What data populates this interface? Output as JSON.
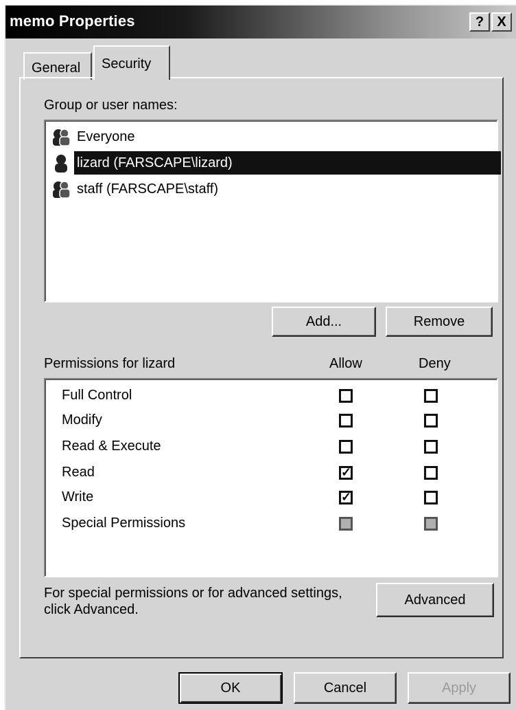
{
  "window": {
    "title": "memo Properties",
    "help_label": "?",
    "close_label": "X"
  },
  "tabs": [
    {
      "label": "General",
      "active": false
    },
    {
      "label": "Security",
      "active": true
    }
  ],
  "groups": {
    "label": "Group or user names:",
    "items": [
      {
        "label": "Everyone",
        "icon": "group-icon",
        "selected": false
      },
      {
        "label": "lizard (FARSCAPE\\lizard)",
        "icon": "user-icon",
        "selected": true
      },
      {
        "label": "staff (FARSCAPE\\staff)",
        "icon": "group-icon",
        "selected": false
      }
    ],
    "add_label": "Add...",
    "remove_label": "Remove"
  },
  "permissions": {
    "label": "Permissions for lizard",
    "allow_header": "Allow",
    "deny_header": "Deny",
    "rows": [
      {
        "name": "Full Control",
        "allow": "unchecked",
        "deny": "unchecked"
      },
      {
        "name": "Modify",
        "allow": "unchecked",
        "deny": "unchecked"
      },
      {
        "name": "Read & Execute",
        "allow": "unchecked",
        "deny": "unchecked"
      },
      {
        "name": "Read",
        "allow": "checked",
        "deny": "unchecked"
      },
      {
        "name": "Write",
        "allow": "checked",
        "deny": "unchecked"
      },
      {
        "name": "Special Permissions",
        "allow": "greyed",
        "deny": "greyed"
      }
    ]
  },
  "advanced": {
    "text_line1": "For special permissions or for advanced settings,",
    "text_line2": "click Advanced.",
    "button_label": "Advanced"
  },
  "footer": {
    "ok_label": "OK",
    "cancel_label": "Cancel",
    "apply_label": "Apply",
    "apply_enabled": false
  },
  "colors": {
    "face": "#d4d4d4",
    "selection": "#111111",
    "title_start": "#000000",
    "title_end": "#c9c9c9"
  }
}
